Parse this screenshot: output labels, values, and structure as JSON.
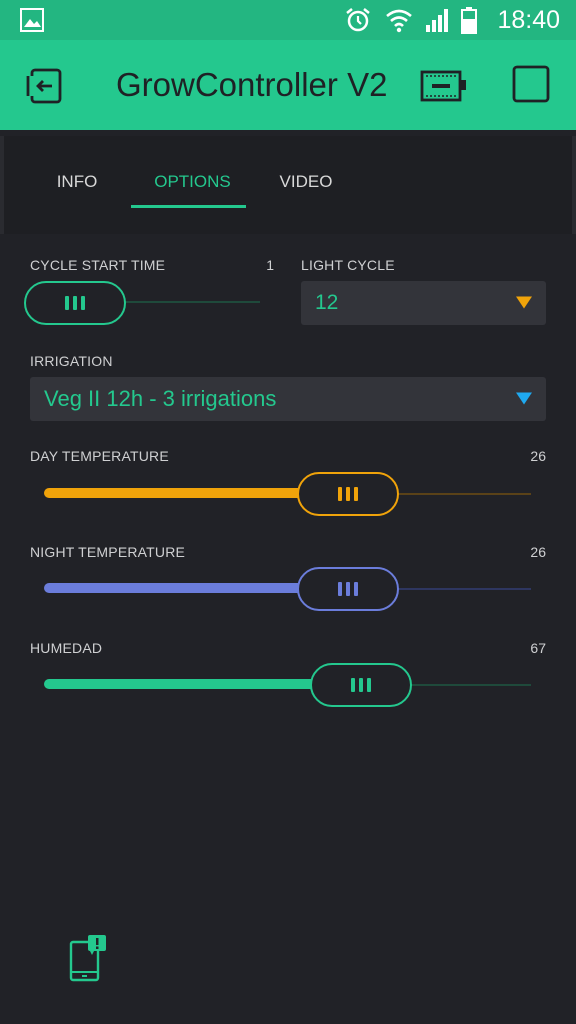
{
  "status_bar": {
    "time": "18:40",
    "icons": [
      "image-icon",
      "alarm-icon",
      "wifi-icon",
      "signal-icon",
      "battery-icon"
    ]
  },
  "header": {
    "title": "GrowController V2",
    "left_icon": "exit-icon",
    "right_icons": [
      "device-icon",
      "stop-square-icon"
    ],
    "background": "#24c88e"
  },
  "tabs": [
    {
      "label": "INFO",
      "active": false
    },
    {
      "label": "OPTIONS",
      "active": true
    },
    {
      "label": "VIDEO",
      "active": false
    }
  ],
  "controls": {
    "cycle_start": {
      "label": "CYCLE START TIME",
      "value": "1",
      "level": 0.0,
      "color": "#24c88e"
    },
    "light_cycle": {
      "label": "LIGHT CYCLE",
      "selected": "12",
      "arrow_color": "#f0a30a"
    },
    "irrigation": {
      "label": "IRRIGATION",
      "selected": "Veg II 12h - 3 irrigations",
      "arrow_color": "#1fa9f0"
    },
    "day_temp": {
      "label": "DAY TEMPERATURE",
      "value": "26",
      "level": 0.62,
      "color": "#f0a30a"
    },
    "night_temp": {
      "label": "NIGHT TEMPERATURE",
      "value": "26",
      "level": 0.62,
      "color": "#6b7ddb"
    },
    "humidity": {
      "label": "HUMEDAD",
      "value": "67",
      "level": 0.67,
      "color": "#24c88e"
    }
  },
  "footer": {
    "icon": "device-notification-icon"
  }
}
